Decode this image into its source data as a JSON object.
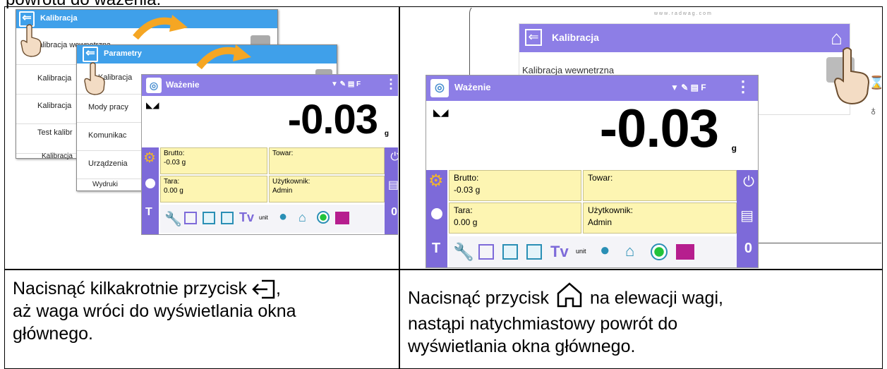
{
  "top_caption": "powrotu do ważenia:",
  "left": {
    "win1_title": "Kalibracja",
    "win1_rows": [
      "Kalibracja wewnętrzna",
      "Kalibracja",
      "Kalibracja",
      "Test kalibr",
      "Kalibracja"
    ],
    "win2_title": "Parametry",
    "win2_rows": [
      "Kalibracja",
      "Mody pracy",
      "Komunikac",
      "Urządzenia",
      "Wydruki"
    ],
    "caption_before_icon": "Nacisnąć kilkakrotnie przycisk",
    "caption_after_icon": ",",
    "caption_line2": "aż waga wróci do wyświetlania okna",
    "caption_line3": "głównego."
  },
  "right": {
    "website": "www.radwag.com",
    "header_title": "Kalibracja",
    "menu_row": "Kalibracja wewnetrzna",
    "caption_before_icon": "Nacisnąć przycisk",
    "caption_after_icon": "na elewacji wagi,",
    "caption_line2": "nastąpi natychmiastowy powrót do",
    "caption_line3": "wyświetlania okna głównego."
  },
  "weighing": {
    "title": "Ważenie",
    "status_icons": "▼ ✎ ▤ F",
    "reading": "-0.03",
    "unit": "g",
    "brutto_label": "Brutto:",
    "brutto_value": "-0.03 g",
    "tara_label": "Tara:",
    "tara_value": "0.00 g",
    "towar_label": "Towar:",
    "user_label": "Użytkownik:",
    "user_value": "Admin",
    "tare_key": "T",
    "zero_key": "0",
    "tv_key": "Tv",
    "unit_key": "unit"
  },
  "colors": {
    "accent_purple": "#8d7ee6",
    "menu_blue": "#3fa0ea",
    "info_yellow": "#fdf5b2",
    "arrow_orange": "#f5a623"
  }
}
